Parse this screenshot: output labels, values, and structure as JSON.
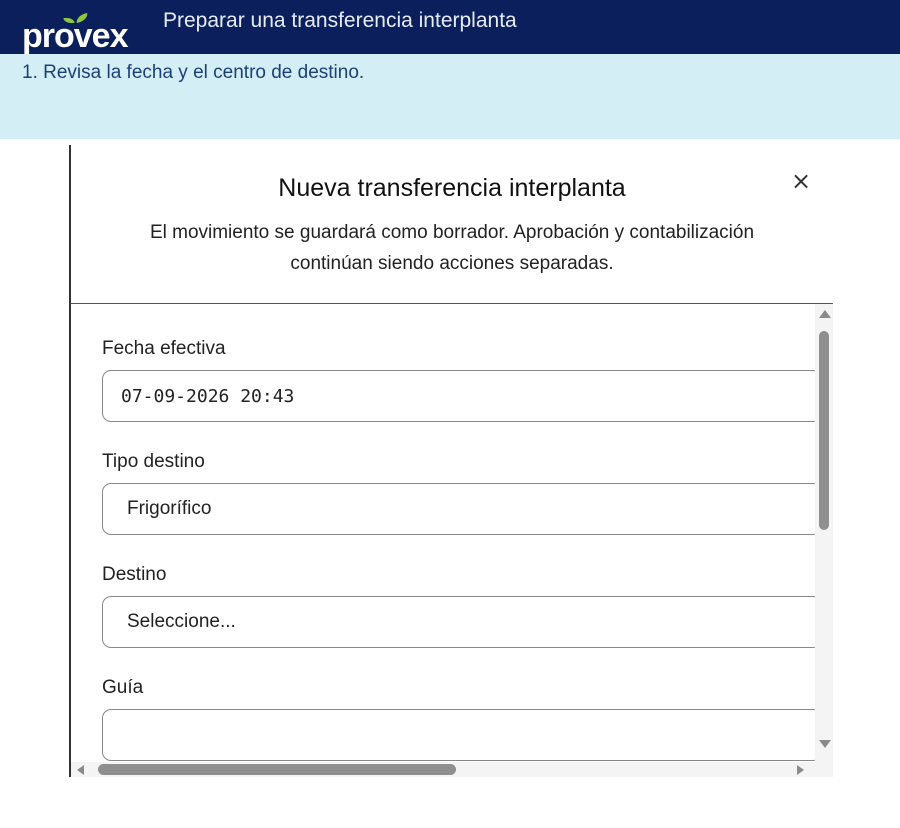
{
  "brand": {
    "name": "provex",
    "leaf_color": "#8dc63f",
    "bar_color": "#0a1f5c"
  },
  "header": {
    "title": "Preparar una transferencia interplanta"
  },
  "instruction": {
    "text": "1. Revisa la fecha y el centro de destino."
  },
  "modal": {
    "title": "Nueva transferencia interplanta",
    "close_icon": "×",
    "subtitle_line1": "El movimiento se guardará como borrador. Aprobación y contabilización",
    "subtitle_line2": "continúan siendo acciones separadas.",
    "fields": {
      "fecha": {
        "label": "Fecha efectiva",
        "value": "07-09-2026 20:43"
      },
      "tipo": {
        "label": "Tipo destino",
        "value": "Frigorífico"
      },
      "destino": {
        "label": "Destino",
        "value": "Seleccione..."
      },
      "guia": {
        "label": "Guía",
        "value": ""
      }
    }
  }
}
